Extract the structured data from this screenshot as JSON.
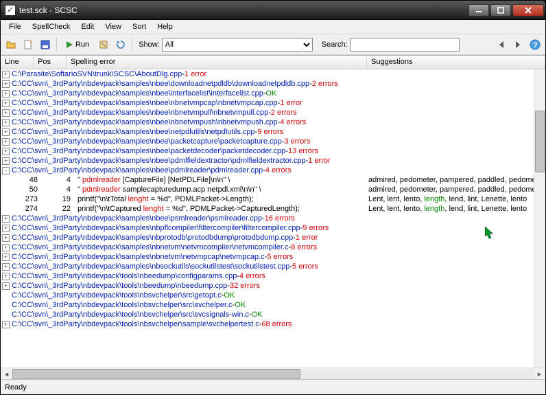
{
  "window": {
    "title": "test.sck - SCSC"
  },
  "menu": {
    "file": "File",
    "spellcheck": "SpellCheck",
    "edit": "Edit",
    "view": "View",
    "sort": "Sort",
    "help": "Help"
  },
  "toolbar": {
    "run_label": "Run",
    "show_label": "Show:",
    "filter_value": "All",
    "search_label": "Search:",
    "search_value": ""
  },
  "columns": {
    "line": "Line",
    "pos": "Pos",
    "err": "Spelling error",
    "sug": "Suggestions"
  },
  "rows": [
    {
      "type": "file",
      "exp": "+",
      "path": "C:\\Parasite\\SoftarioSVN\\trunk\\SCSC\\AboutDlg.cpp",
      "status": "1 error",
      "statusClass": "err"
    },
    {
      "type": "file",
      "exp": "+",
      "path": "C:\\CC\\svn\\_3rdParty\\nbdevpack\\samples\\nbee\\downloadnetpdldb\\downloadnetpdldb.cpp",
      "status": "2 errors",
      "statusClass": "err"
    },
    {
      "type": "file",
      "exp": "+",
      "path": "C:\\CC\\svn\\_3rdParty\\nbdevpack\\samples\\nbee\\interfacelist\\interfacelist.cpp",
      "status": "OK",
      "statusClass": "ok"
    },
    {
      "type": "file",
      "exp": "+",
      "path": "C:\\CC\\svn\\_3rdParty\\nbdevpack\\samples\\nbee\\nbnetvmpcap\\nbnetvmpcap.cpp",
      "status": "1 error",
      "statusClass": "err"
    },
    {
      "type": "file",
      "exp": "+",
      "path": "C:\\CC\\svn\\_3rdParty\\nbdevpack\\samples\\nbee\\nbnetvmpull\\nbnetvmpull.cpp",
      "status": "2 errors",
      "statusClass": "err"
    },
    {
      "type": "file",
      "exp": "+",
      "path": "C:\\CC\\svn\\_3rdParty\\nbdevpack\\samples\\nbee\\nbnetvmpush\\nbnetvmpush.cpp",
      "status": "4 errors",
      "statusClass": "err"
    },
    {
      "type": "file",
      "exp": "+",
      "path": "C:\\CC\\svn\\_3rdParty\\nbdevpack\\samples\\nbee\\netpdlutils\\netpdlutils.cpp",
      "status": "9 errors",
      "statusClass": "err"
    },
    {
      "type": "file",
      "exp": "+",
      "path": "C:\\CC\\svn\\_3rdParty\\nbdevpack\\samples\\nbee\\packetcapture\\packetcapture.cpp",
      "status": "3 errors",
      "statusClass": "err"
    },
    {
      "type": "file",
      "exp": "+",
      "path": "C:\\CC\\svn\\_3rdParty\\nbdevpack\\samples\\nbee\\packetdecoder\\packetdecoder.cpp",
      "status": "13 errors",
      "statusClass": "err"
    },
    {
      "type": "file",
      "exp": "+",
      "path": "C:\\CC\\svn\\_3rdParty\\nbdevpack\\samples\\nbee\\pdmlfieldextractor\\pdmlfieldextractor.cpp",
      "status": "1 error",
      "statusClass": "err"
    },
    {
      "type": "file",
      "exp": "-",
      "path": "C:\\CC\\svn\\_3rdParty\\nbdevpack\\samples\\nbee\\pdmlreader\\pdmlreader.cpp",
      "status": "4 errors",
      "statusClass": "err"
    },
    {
      "type": "detail",
      "line": "48",
      "pos": "4",
      "pre": "\" ",
      "word": "pdmlreader",
      "wordClass": "highlight-word",
      "post": " [CaptureFile] [NetPDLFile]\\n\\n\"  \\",
      "suggest": "admired, pedometer, pampered, paddled, pedometers"
    },
    {
      "type": "detail",
      "line": "50",
      "pos": "4",
      "pre": "\" ",
      "word": "pdmlreader",
      "wordClass": "highlight-word",
      "post": " samplecapturedump.acp netpdl.xml\\n\\n\"  \\",
      "suggest": "admired, pedometer, pampered, paddled, pedometers"
    },
    {
      "type": "detail",
      "line": "273",
      "pos": "19",
      "pre": "printf(\"\\n\\tTotal ",
      "word": "lenght",
      "wordClass": "highlight-word",
      "post": "= %d\", PDMLPacket->Length);",
      "suggest": "Lent, lent, lento, ",
      "sugword": "length",
      "sugpost": ", lend, lint, Lenette, lento"
    },
    {
      "type": "detail",
      "line": "274",
      "pos": "22",
      "pre": "printf(\"\\n\\tCaptured ",
      "word": "lenght",
      "wordClass": "highlight-word",
      "post": "= %d\", PDMLPacket->CapturedLength);",
      "suggest": "Lent, lent, lento, ",
      "sugword": "length",
      "sugpost": ", lend, lint, Lenette, lento"
    },
    {
      "type": "file",
      "exp": "+",
      "path": "C:\\CC\\svn\\_3rdParty\\nbdevpack\\samples\\nbee\\psmlreader\\psmlreader.cpp",
      "status": "16 errors",
      "statusClass": "err"
    },
    {
      "type": "file",
      "exp": "+",
      "path": "C:\\CC\\svn\\_3rdParty\\nbdevpack\\samples\\nbpflcompiler\\filtercompiler\\filtercompiler.cpp",
      "status": "9 errors",
      "statusClass": "err"
    },
    {
      "type": "file",
      "exp": "+",
      "path": "C:\\CC\\svn\\_3rdParty\\nbdevpack\\samples\\nbprotodb\\protodbdump\\protodbdump.cpp",
      "status": "1 error",
      "statusClass": "err"
    },
    {
      "type": "file",
      "exp": "+",
      "path": "C:\\CC\\svn\\_3rdParty\\nbdevpack\\samples\\nbnetvm\\netvmcompiler\\netvmcompiler.c",
      "status": "8 errors",
      "statusClass": "err"
    },
    {
      "type": "file",
      "exp": "+",
      "path": "C:\\CC\\svn\\_3rdParty\\nbdevpack\\samples\\nbnetvm\\netvmpcap\\netvmpcap.c",
      "status": "5 errors",
      "statusClass": "err"
    },
    {
      "type": "file",
      "exp": "+",
      "path": "C:\\CC\\svn\\_3rdParty\\nbdevpack\\samples\\nbsockutils\\sockutilstest\\sockutilstest.cpp",
      "status": "5 errors",
      "statusClass": "err"
    },
    {
      "type": "file",
      "exp": "+",
      "path": "C:\\CC\\svn\\_3rdParty\\nbdevpack\\tools\\nbeedump\\configparams.cpp",
      "status": "4 errors",
      "statusClass": "err"
    },
    {
      "type": "file",
      "exp": "+",
      "path": "C:\\CC\\svn\\_3rdParty\\nbdevpack\\tools\\nbeedump\\nbeedump.cpp",
      "status": "32 errors",
      "statusClass": "err"
    },
    {
      "type": "file",
      "exp": "",
      "path": "C:\\CC\\svn\\_3rdParty\\nbdevpack\\tools\\nbsvchelper\\src\\getopt.c",
      "status": "OK",
      "statusClass": "ok"
    },
    {
      "type": "file",
      "exp": "",
      "path": "C:\\CC\\svn\\_3rdParty\\nbdevpack\\tools\\nbsvchelper\\src\\svchelper.c",
      "status": "OK",
      "statusClass": "ok"
    },
    {
      "type": "file",
      "exp": "",
      "path": "C:\\CC\\svn\\_3rdParty\\nbdevpack\\tools\\nbsvchelper\\src\\svcsignals-win.c",
      "status": "OK",
      "statusClass": "ok"
    },
    {
      "type": "file",
      "exp": "+",
      "path": "C:\\CC\\svn\\_3rdParty\\nbdevpack\\tools\\nbsvchelper\\sample\\svchelpertest.c",
      "status": "68 errors",
      "statusClass": "err"
    }
  ],
  "status": {
    "text": "Ready"
  }
}
